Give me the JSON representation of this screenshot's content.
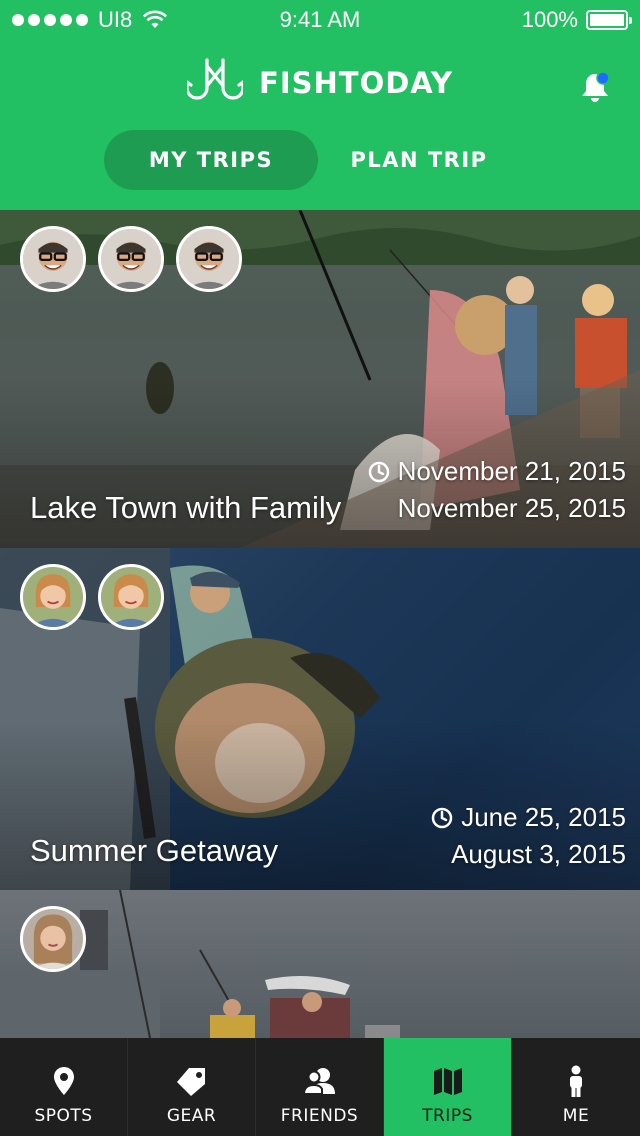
{
  "status_bar": {
    "carrier": "UI8",
    "time": "9:41 AM",
    "battery": "100%"
  },
  "header": {
    "app_name": "FISHTODAY",
    "notification_dot": true
  },
  "tabs": [
    {
      "label": "MY TRIPS",
      "selected": true
    },
    {
      "label": "PLAN TRIP",
      "selected": false
    }
  ],
  "trips": [
    {
      "title": "Lake Town with Family",
      "start_date": "November 21, 2015",
      "end_date": "November 25, 2015",
      "participants": 3
    },
    {
      "title": "Summer Getaway",
      "start_date": "June 25, 2015",
      "end_date": "August 3, 2015",
      "participants": 2
    },
    {
      "title": "",
      "start_date": "",
      "end_date": "",
      "participants": 1
    }
  ],
  "bottom_nav": [
    {
      "label": "SPOTS",
      "icon": "map-pin-icon",
      "active": false
    },
    {
      "label": "GEAR",
      "icon": "tag-icon",
      "active": false
    },
    {
      "label": "FRIENDS",
      "icon": "friends-icon",
      "active": false
    },
    {
      "label": "TRIPS",
      "icon": "map-icon",
      "active": true
    },
    {
      "label": "ME",
      "icon": "person-icon",
      "active": false
    }
  ],
  "colors": {
    "brand_green": "#22c063",
    "tab_active": "#1e9d52",
    "nav_bg": "#1f1f1f",
    "notification": "#1e6bff"
  }
}
